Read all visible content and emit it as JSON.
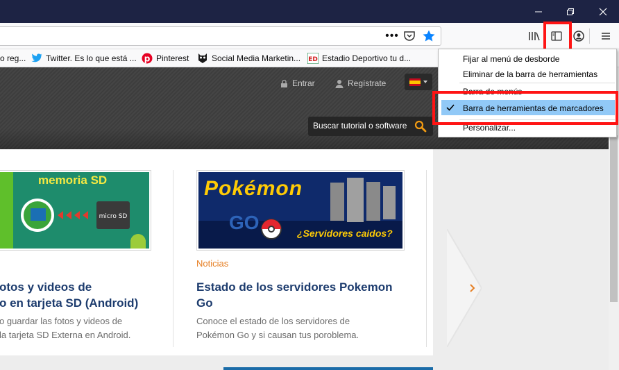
{
  "bookmarks": [
    {
      "label": "o reg...",
      "icon": "globe-icon"
    },
    {
      "label": "Twitter. Es lo que está ...",
      "icon": "twitter-icon"
    },
    {
      "label": "Pinterest",
      "icon": "pinterest-icon"
    },
    {
      "label": "Social Media Marketin...",
      "icon": "owl-icon"
    },
    {
      "label": "Estadio Deportivo tu d...",
      "icon": "ed-logo-icon"
    }
  ],
  "header": {
    "login": "Entrar",
    "register": "Regístrate",
    "search_placeholder": "Buscar tutorial o software"
  },
  "cards": [
    {
      "thumb_text": "memoria SD",
      "title_lines": [
        "otos y videos de",
        "o en tarjeta SD (Android)"
      ],
      "desc_lines": [
        "o guardar las fotos y videos de",
        "la tarjeta SD Externa en Android."
      ]
    },
    {
      "thumb_title": "Pokémon",
      "thumb_subtitle": "GO",
      "thumb_caption": "¿Servidores caidos?",
      "category": "Noticias",
      "title_lines": [
        "Estado de los servidores Pokemon",
        "Go"
      ],
      "desc_lines": [
        "Conoce el estado de los servidores de",
        "Pokémon Go y si causan tus poroblema."
      ]
    }
  ],
  "menu": {
    "items": [
      "Fijar al menú de desborde",
      "Eliminar de la barra de herramientas",
      "Barra de menús",
      "Barra de herramientas de marcadores",
      "Personalizar..."
    ],
    "checked_index": 3
  },
  "colors": {
    "titlebar": "#1d2344",
    "highlight": "#91c9f7",
    "annotation_red": "#ff1414",
    "card_title": "#1d3c6e",
    "category": "#e67e22"
  }
}
